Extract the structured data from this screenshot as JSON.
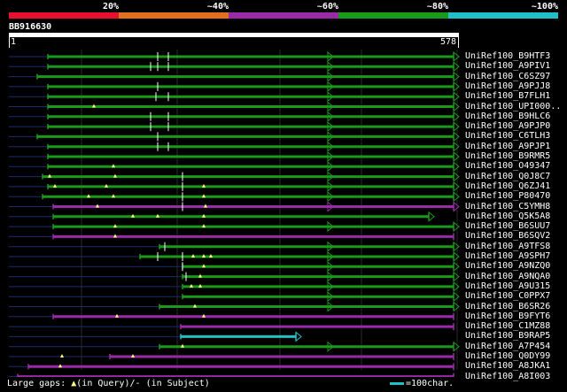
{
  "colors": {
    "red": "#e8102c",
    "orange": "#e07020",
    "purple": "#9a2aa8",
    "green": "#1a9a1a",
    "cyan": "#20c0c8",
    "query": "#ffffff",
    "gap_line": "#1c2a70",
    "triangle": "#ffff80"
  },
  "scale": {
    "labels": [
      "20%",
      "~40%",
      "~60%",
      "~80%",
      "~100%"
    ]
  },
  "query": {
    "name": "BB916630",
    "start": "1",
    "end": "578"
  },
  "hits": [
    {
      "name": "UniRef100_B9HTF3",
      "color": "green"
    },
    {
      "name": "UniRef100_A9PIV1",
      "color": "green"
    },
    {
      "name": "UniRef100_C6SZ97",
      "color": "green"
    },
    {
      "name": "UniRef100_A9PJJ8",
      "color": "green"
    },
    {
      "name": "UniRef100_B7FLH1",
      "color": "green"
    },
    {
      "name": "UniRef100_UPI000..",
      "color": "green"
    },
    {
      "name": "UniRef100_B9HLC6",
      "color": "green"
    },
    {
      "name": "UniRef100_A9PJP0",
      "color": "green"
    },
    {
      "name": "UniRef100_C6TLH3",
      "color": "green"
    },
    {
      "name": "UniRef100_A9PJP1",
      "color": "green"
    },
    {
      "name": "UniRef100_B9RMR5",
      "color": "green"
    },
    {
      "name": "UniRef100_O49347",
      "color": "green"
    },
    {
      "name": "UniRef100_Q0J8C7",
      "color": "green"
    },
    {
      "name": "UniRef100_Q6ZJ41",
      "color": "green"
    },
    {
      "name": "UniRef100_P80470",
      "color": "green"
    },
    {
      "name": "UniRef100_C5YMH8",
      "color": "purple"
    },
    {
      "name": "UniRef100_Q5K5A8",
      "color": "green"
    },
    {
      "name": "UniRef100_B6SUU7",
      "color": "green"
    },
    {
      "name": "UniRef100_B6SQV2",
      "color": "purple"
    },
    {
      "name": "UniRef100_A9TFS8",
      "color": "green"
    },
    {
      "name": "UniRef100_A9SPH7",
      "color": "green"
    },
    {
      "name": "UniRef100_A9NZQ0",
      "color": "green"
    },
    {
      "name": "UniRef100_A9NQA0",
      "color": "green"
    },
    {
      "name": "UniRef100_A9U315",
      "color": "green"
    },
    {
      "name": "UniRef100_C0PPX7",
      "color": "green"
    },
    {
      "name": "UniRef100_B6SR26",
      "color": "green"
    },
    {
      "name": "UniRef100_B9FYT6",
      "color": "purple"
    },
    {
      "name": "UniRef100_C1MZ88",
      "color": "purple"
    },
    {
      "name": "UniRef100_B9RAP5",
      "color": "cyan"
    },
    {
      "name": "UniRef100_A7P454",
      "color": "green"
    },
    {
      "name": "UniRef100_Q0DY99",
      "color": "purple"
    },
    {
      "name": "UniRef100_A8JKA1",
      "color": "purple"
    },
    {
      "name": "UniRef100_A8I003",
      "color": "purple"
    }
  ],
  "legend": {
    "gaps_prefix": "Large gaps: ",
    "gaps_query": "(in Query)/",
    "gaps_dash": "-",
    "gaps_subject": " (in Subject)",
    "scale_text": "=100char."
  }
}
